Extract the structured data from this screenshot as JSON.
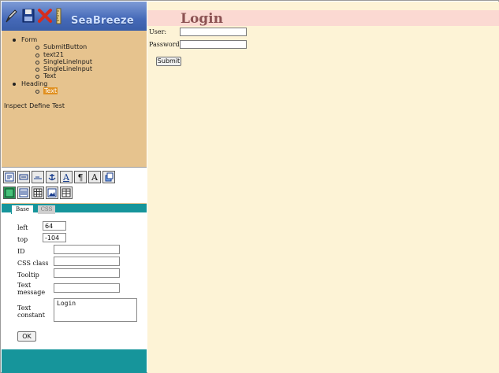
{
  "brand": {
    "name": "SeaBreeze"
  },
  "toolbar": {
    "icons": [
      "pencil-icon",
      "save-icon",
      "delete-icon",
      "ruler-icon"
    ]
  },
  "tree": {
    "form_label": "Form",
    "form_children": [
      "SubmitButton",
      "text21",
      "SingleLineInput",
      "SingleLineInput",
      "Text"
    ],
    "heading_label": "Heading",
    "heading_child": "Text"
  },
  "actions": {
    "inspect": "Inspect",
    "define": "Define",
    "test": "Test"
  },
  "palette": {
    "row1": [
      "form-widget-icon",
      "button-widget-icon",
      "input-widget-icon",
      "anchor-icon",
      "link-text-icon",
      "paragraph-icon",
      "text-icon",
      "refresh-icon"
    ],
    "row2": [
      "image-icon",
      "list-icon",
      "grid-icon",
      "picture-icon",
      "table-icon"
    ]
  },
  "props": {
    "tabs": {
      "base": "Base",
      "css": "CSS"
    },
    "left_label": "left",
    "left_value": "64",
    "top_label": "top",
    "top_value": "-104",
    "id_label": "ID",
    "css_class_label": "CSS class",
    "tooltip_label": "Tooltip",
    "text_message_label": "Text message",
    "text_constant_label": "Text constant",
    "text_constant_value": "Login",
    "ok_label": "OK"
  },
  "page": {
    "title": "Login",
    "user_label": "User:",
    "password_label": "Password:",
    "submit_label": "Submit"
  },
  "colors": {
    "sidebar": "#e6c38e",
    "header_blue": "#4569b8",
    "teal": "#16959b",
    "page_bg": "#fdf3d6",
    "heading_bg": "#fbd9d2",
    "title": "#8c5253",
    "selection": "#e09020"
  }
}
